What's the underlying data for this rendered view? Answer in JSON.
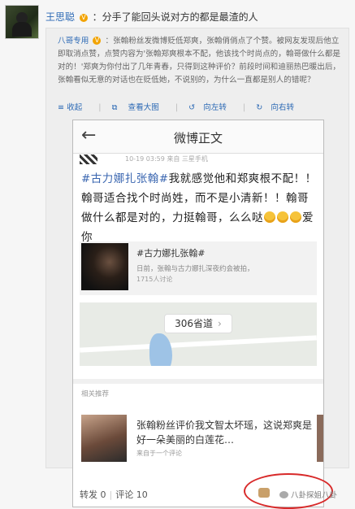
{
  "post": {
    "author": "王思聪",
    "vmark": "V",
    "text": "：分手了能回头说对方的都是最渣的人"
  },
  "repost": {
    "author": "八哥专用",
    "vmark": "V",
    "text": "：张翰粉丝发微博贬低郑爽，张翰俏俏点了个赞。被网友发现后他立即取消点赞，点赞内容为'张翰郑爽根本不配，他该找个时尚点的，翰哥做什么都是对的！'郑爽为你付出了几年青春，只得到这种评价？前段时间和迪丽热巴暖出后，张翰看似无意的对话也在贬低她，不说别的，为什么一直都是别人的错呢？",
    "actions": {
      "collapse": "收起",
      "view_large": "查看大图",
      "rotate_left": "向左转",
      "rotate_right": "向右转"
    }
  },
  "screenshot": {
    "title": "微博正文",
    "meta_time": "10-19 03:59  来自 三星手机",
    "tag_text": "#古力娜扎张翰#",
    "body_text": "我就感觉他和郑爽根不配！！翰哥适合找个时尚姓，而不是小清新！！翰哥做什么都是对的，力挺翰哥，么么哒",
    "body_end": "爱你",
    "card": {
      "title": "#古力娜扎张翰#",
      "desc": "日前，张翰与古力娜扎深夜约会被拍，",
      "count": "1715人讨论"
    },
    "map_label": "306省道",
    "related_label": "相关推荐",
    "related": {
      "title": "张翰粉丝评价我文智太坏瑶，这说郑爽是好一朵美丽的白莲花…",
      "sub": "来自于一个评论"
    },
    "stats": {
      "repost": "转发 0",
      "comment": "评论 10",
      "sep": "|"
    }
  },
  "watermark": "八卦探姐八卦"
}
